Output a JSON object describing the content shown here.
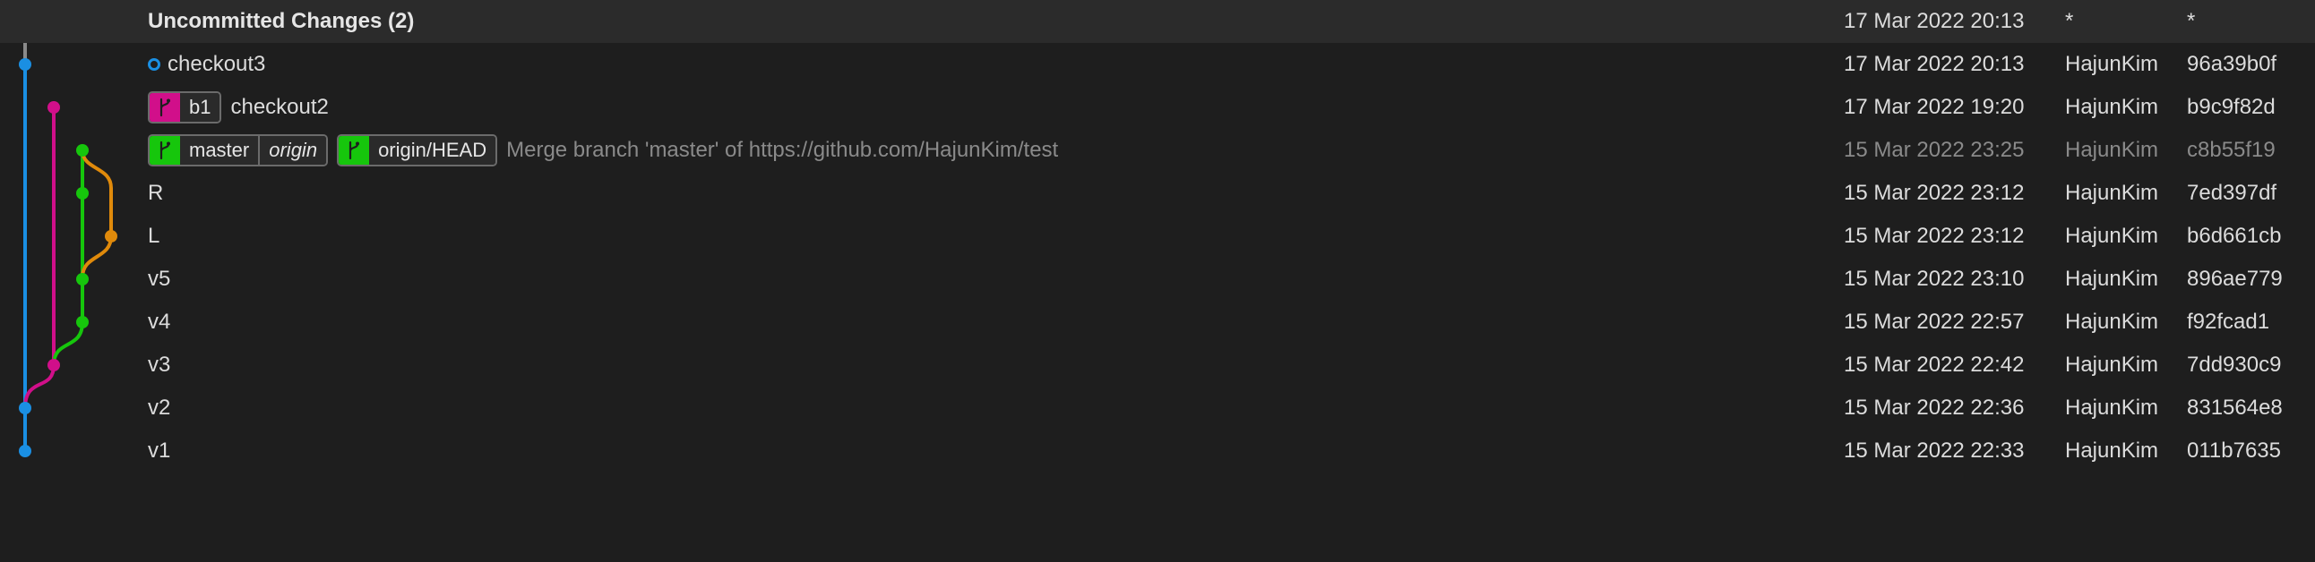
{
  "colors": {
    "background": "#1e1e1e",
    "uncommitted_bg": "#2b2b2b",
    "lane_blue": "#1a8fe3",
    "lane_pink": "#d10f8a",
    "lane_green": "#16c60c",
    "lane_orange": "#e08a0b",
    "uncommitted_gray": "#8a8a8a"
  },
  "uncommitted": {
    "title": "Uncommitted Changes (2)",
    "date": "17 Mar 2022 20:13",
    "author": "*",
    "hash": "*"
  },
  "commits": [
    {
      "message": "checkout3",
      "date": "17 Mar 2022 20:13",
      "author": "HajunKim",
      "hash": "96a39b0f"
    },
    {
      "message": "checkout2",
      "date": "17 Mar 2022 19:20",
      "author": "HajunKim",
      "hash": "b9c9f82d",
      "ref": {
        "name": "b1",
        "icon": "branch-icon"
      }
    },
    {
      "message": "Merge branch 'master' of https://github.com/HajunKim/test",
      "date": "15 Mar 2022 23:25",
      "author": "HajunKim",
      "hash": "c8b55f19",
      "ref1": {
        "name": "master",
        "remote": "origin",
        "icon": "branch-icon"
      },
      "ref2": {
        "name": "origin/HEAD",
        "icon": "branch-icon"
      }
    },
    {
      "message": "R",
      "date": "15 Mar 2022 23:12",
      "author": "HajunKim",
      "hash": "7ed397df"
    },
    {
      "message": "L",
      "date": "15 Mar 2022 23:12",
      "author": "HajunKim",
      "hash": "b6d661cb"
    },
    {
      "message": "v5",
      "date": "15 Mar 2022 23:10",
      "author": "HajunKim",
      "hash": "896ae779"
    },
    {
      "message": "v4",
      "date": "15 Mar 2022 22:57",
      "author": "HajunKim",
      "hash": "f92fcad1"
    },
    {
      "message": "v3",
      "date": "15 Mar 2022 22:42",
      "author": "HajunKim",
      "hash": "7dd930c9"
    },
    {
      "message": "v2",
      "date": "15 Mar 2022 22:36",
      "author": "HajunKim",
      "hash": "831564e8"
    },
    {
      "message": "v1",
      "date": "15 Mar 2022 22:33",
      "author": "HajunKim",
      "hash": "011b7635"
    }
  ]
}
